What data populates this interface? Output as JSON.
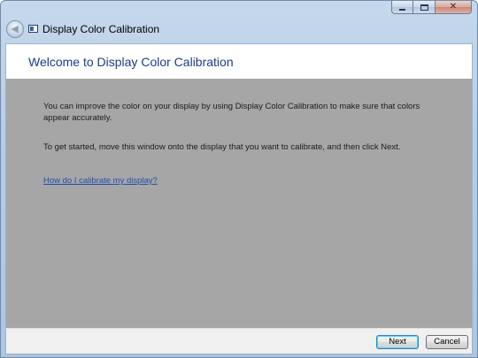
{
  "window": {
    "title": "Display Color Calibration",
    "caption_buttons": {
      "minimize_icon": "minimize-icon",
      "maximize_icon": "maximize-icon",
      "close_icon": "close-icon"
    },
    "back_icon": "back-arrow-icon",
    "app_icon": "display-icon"
  },
  "header": {
    "title": "Welcome to Display Color Calibration"
  },
  "content": {
    "paragraph_1": "You can improve the color on your display by using Display Color Calibration to make sure that colors appear accurately.",
    "paragraph_2": "To get started, move this window onto the display that you want to calibrate, and then click Next.",
    "help_link": "How do I calibrate my display?"
  },
  "footer": {
    "next_label": "Next",
    "cancel_label": "Cancel"
  },
  "colors": {
    "header_title": "#1d3a8a",
    "content_background": "#a6a6a6",
    "link": "#1f4fae",
    "frame": "#b7cde6"
  }
}
